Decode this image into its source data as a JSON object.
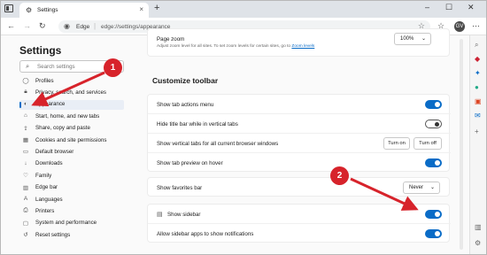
{
  "browser": {
    "tab_title": "Settings",
    "address_prefix": "Edge",
    "url": "edge://settings/appearance",
    "avatar_initial": "GV"
  },
  "leftnav": {
    "title": "Settings",
    "search_placeholder": "Search settings",
    "items": [
      {
        "label": "Profiles",
        "icon": "person-icon"
      },
      {
        "label": "Privacy, search, and services",
        "icon": "lock-icon"
      },
      {
        "label": "Appearance",
        "icon": "appearance-icon",
        "active": true
      },
      {
        "label": "Start, home, and new tabs",
        "icon": "home-icon"
      },
      {
        "label": "Share, copy and paste",
        "icon": "share-icon"
      },
      {
        "label": "Cookies and site permissions",
        "icon": "cookie-icon"
      },
      {
        "label": "Default browser",
        "icon": "browser-icon"
      },
      {
        "label": "Downloads",
        "icon": "download-icon"
      },
      {
        "label": "Family",
        "icon": "family-icon"
      },
      {
        "label": "Edge bar",
        "icon": "edge-bar-icon"
      },
      {
        "label": "Languages",
        "icon": "languages-icon"
      },
      {
        "label": "Printers",
        "icon": "printer-icon"
      },
      {
        "label": "System and performance",
        "icon": "system-icon"
      },
      {
        "label": "Reset settings",
        "icon": "reset-icon"
      }
    ]
  },
  "page_zoom": {
    "label": "Page zoom",
    "sub_before": "Adjust zoom level for all sites. To set zoom levels for certain sites, go to ",
    "sub_link": "Zoom levels",
    "value": "100%"
  },
  "toolbar_section": {
    "title": "Customize toolbar",
    "rows": [
      {
        "label": "Show tab actions menu",
        "control": "toggle",
        "on": true
      },
      {
        "label": "Hide title bar while in vertical tabs",
        "control": "toggle",
        "on": false
      },
      {
        "label": "Show vertical tabs for all current browser windows",
        "control": "buttons",
        "buttons": [
          "Turn on",
          "Turn off"
        ]
      },
      {
        "label": "Show tab preview on hover",
        "control": "toggle",
        "on": true
      }
    ]
  },
  "favorites": {
    "label": "Show favorites bar",
    "value": "Never"
  },
  "sidebar_section": {
    "rows": [
      {
        "label": "Show sidebar",
        "control": "toggle",
        "on": true
      },
      {
        "label": "Allow sidebar apps to show notifications",
        "control": "toggle",
        "on": true
      }
    ]
  },
  "callouts": [
    "1",
    "2"
  ],
  "colors": {
    "accent": "#0a6cc7",
    "callout": "#d7232b"
  }
}
